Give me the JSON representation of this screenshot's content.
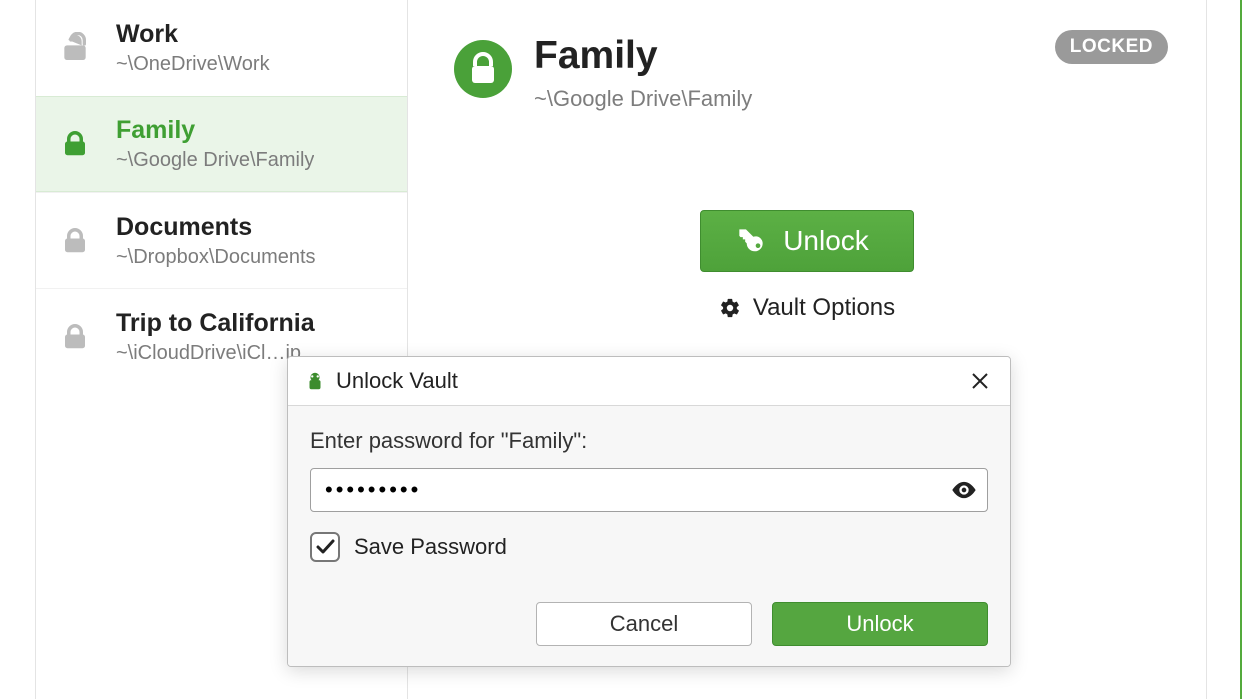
{
  "colors": {
    "accent": "#55a640",
    "muted": "#7d7d7d"
  },
  "sidebar": {
    "items": [
      {
        "name": "Work",
        "path": "~\\OneDrive\\Work",
        "locked": false,
        "selected": false
      },
      {
        "name": "Family",
        "path": "~\\Google Drive\\Family",
        "locked": true,
        "selected": true
      },
      {
        "name": "Documents",
        "path": "~\\Dropbox\\Documents",
        "locked": true,
        "selected": false
      },
      {
        "name": "Trip to California",
        "path": "~\\iCloudDrive\\iCl…ip ",
        "locked": true,
        "selected": false
      }
    ]
  },
  "detail": {
    "title": "Family",
    "path": "~\\Google Drive\\Family",
    "locked_badge": "LOCKED",
    "unlock_label": "Unlock",
    "options_label": "Vault Options"
  },
  "dialog": {
    "title": "Unlock Vault",
    "prompt": "Enter password for \"Family\":",
    "password_value": "•••••••••",
    "save_label": "Save Password",
    "save_checked": true,
    "cancel_label": "Cancel",
    "unlock_label": "Unlock"
  }
}
